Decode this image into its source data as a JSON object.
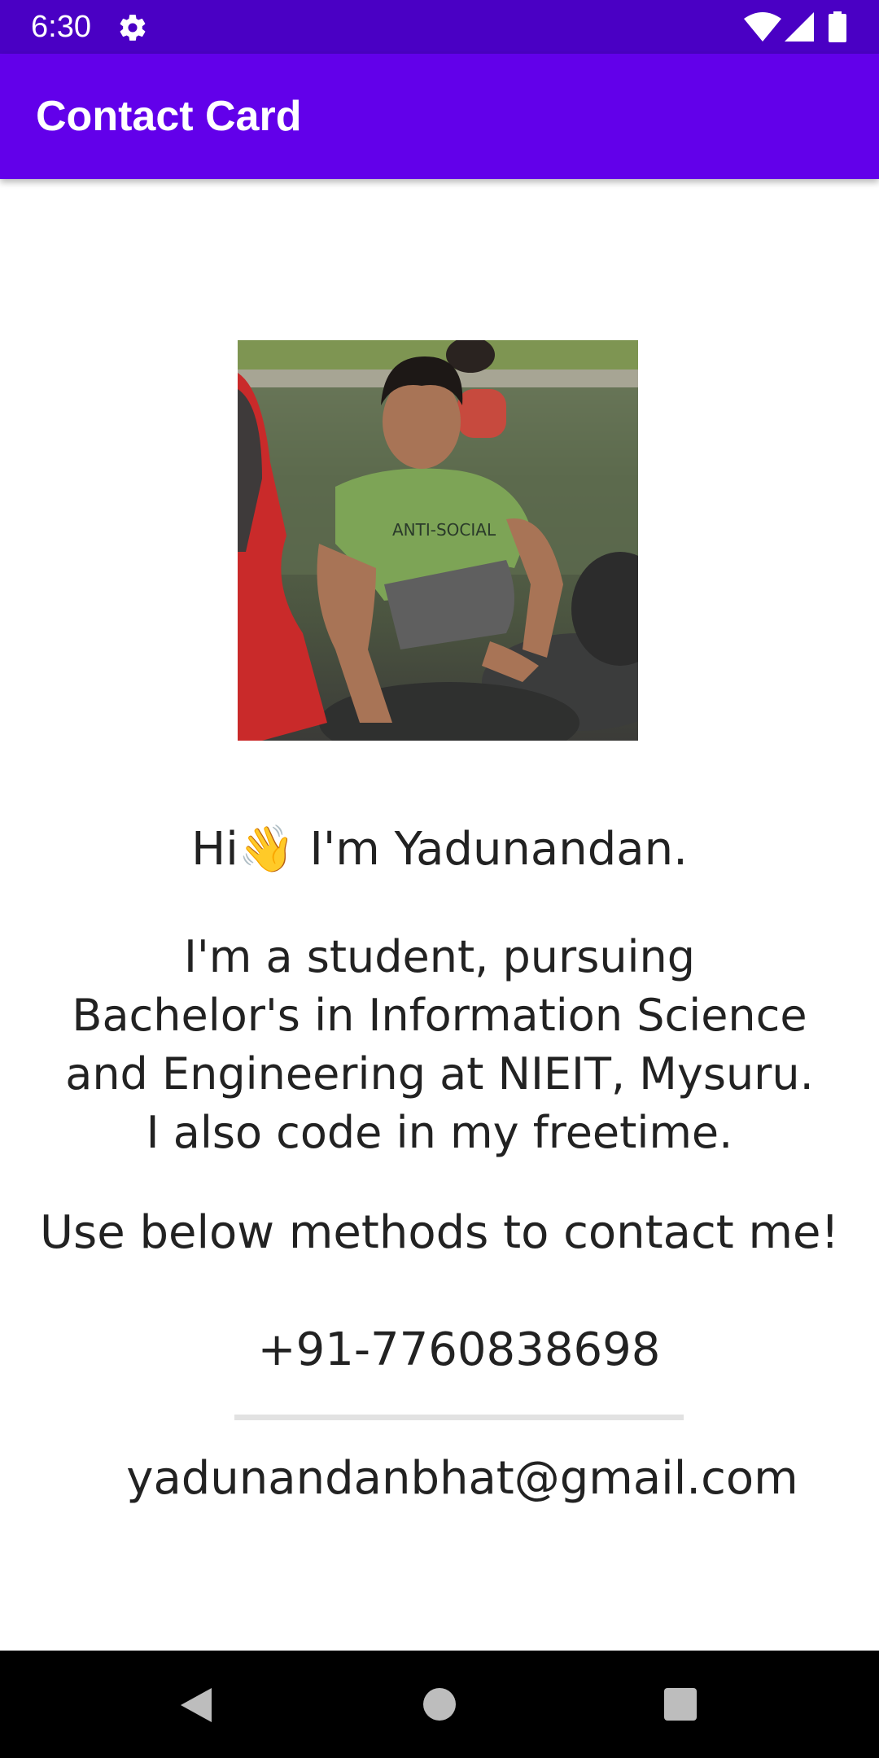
{
  "status_bar": {
    "time": "6:30",
    "icons": [
      "gear-icon",
      "wifi-icon",
      "signal-icon",
      "battery-icon"
    ],
    "color": "#4a00c4"
  },
  "app_bar": {
    "title": "Contact Card",
    "color": "#6200ea"
  },
  "profile": {
    "photo_description_icon": "profile-photo",
    "greeting_prefix": "Hi",
    "greeting_emoji": "👋",
    "greeting_suffix": " I'm Yadunandan.",
    "bio": "I'm a student, pursuing Bachelor's in Information Science and Engineering at NIEIT, Mysuru. I also code in my freetime.",
    "cta": "Use below methods to contact me!",
    "phone": "+91-7760838698",
    "email": "yadunandanbhat@gmail.com"
  },
  "nav_bar": {
    "icons": [
      "back-icon",
      "home-icon",
      "recents-icon"
    ]
  },
  "colors": {
    "text": "#222222",
    "divider": "#e2e2e2",
    "nav_bar": "#000000"
  }
}
